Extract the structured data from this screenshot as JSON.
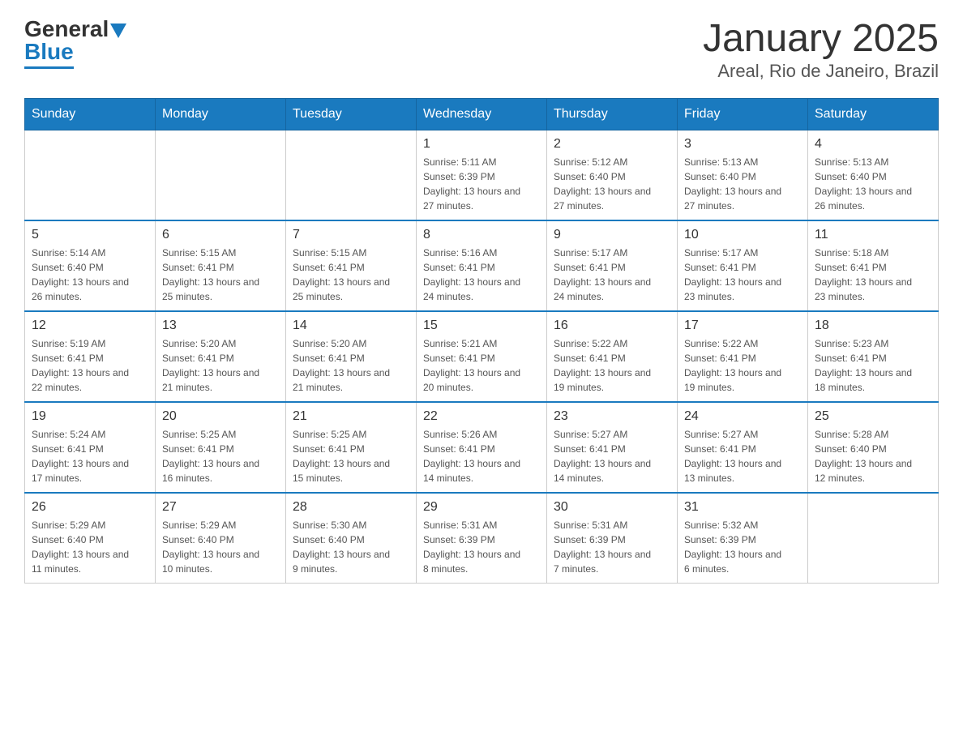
{
  "logo": {
    "general": "General",
    "blue": "Blue",
    "tagline": "GeneralBlue"
  },
  "title": "January 2025",
  "subtitle": "Areal, Rio de Janeiro, Brazil",
  "days_of_week": [
    "Sunday",
    "Monday",
    "Tuesday",
    "Wednesday",
    "Thursday",
    "Friday",
    "Saturday"
  ],
  "weeks": [
    [
      {
        "day": "",
        "sunrise": "",
        "sunset": "",
        "daylight": ""
      },
      {
        "day": "",
        "sunrise": "",
        "sunset": "",
        "daylight": ""
      },
      {
        "day": "",
        "sunrise": "",
        "sunset": "",
        "daylight": ""
      },
      {
        "day": "1",
        "sunrise": "Sunrise: 5:11 AM",
        "sunset": "Sunset: 6:39 PM",
        "daylight": "Daylight: 13 hours and 27 minutes."
      },
      {
        "day": "2",
        "sunrise": "Sunrise: 5:12 AM",
        "sunset": "Sunset: 6:40 PM",
        "daylight": "Daylight: 13 hours and 27 minutes."
      },
      {
        "day": "3",
        "sunrise": "Sunrise: 5:13 AM",
        "sunset": "Sunset: 6:40 PM",
        "daylight": "Daylight: 13 hours and 27 minutes."
      },
      {
        "day": "4",
        "sunrise": "Sunrise: 5:13 AM",
        "sunset": "Sunset: 6:40 PM",
        "daylight": "Daylight: 13 hours and 26 minutes."
      }
    ],
    [
      {
        "day": "5",
        "sunrise": "Sunrise: 5:14 AM",
        "sunset": "Sunset: 6:40 PM",
        "daylight": "Daylight: 13 hours and 26 minutes."
      },
      {
        "day": "6",
        "sunrise": "Sunrise: 5:15 AM",
        "sunset": "Sunset: 6:41 PM",
        "daylight": "Daylight: 13 hours and 25 minutes."
      },
      {
        "day": "7",
        "sunrise": "Sunrise: 5:15 AM",
        "sunset": "Sunset: 6:41 PM",
        "daylight": "Daylight: 13 hours and 25 minutes."
      },
      {
        "day": "8",
        "sunrise": "Sunrise: 5:16 AM",
        "sunset": "Sunset: 6:41 PM",
        "daylight": "Daylight: 13 hours and 24 minutes."
      },
      {
        "day": "9",
        "sunrise": "Sunrise: 5:17 AM",
        "sunset": "Sunset: 6:41 PM",
        "daylight": "Daylight: 13 hours and 24 minutes."
      },
      {
        "day": "10",
        "sunrise": "Sunrise: 5:17 AM",
        "sunset": "Sunset: 6:41 PM",
        "daylight": "Daylight: 13 hours and 23 minutes."
      },
      {
        "day": "11",
        "sunrise": "Sunrise: 5:18 AM",
        "sunset": "Sunset: 6:41 PM",
        "daylight": "Daylight: 13 hours and 23 minutes."
      }
    ],
    [
      {
        "day": "12",
        "sunrise": "Sunrise: 5:19 AM",
        "sunset": "Sunset: 6:41 PM",
        "daylight": "Daylight: 13 hours and 22 minutes."
      },
      {
        "day": "13",
        "sunrise": "Sunrise: 5:20 AM",
        "sunset": "Sunset: 6:41 PM",
        "daylight": "Daylight: 13 hours and 21 minutes."
      },
      {
        "day": "14",
        "sunrise": "Sunrise: 5:20 AM",
        "sunset": "Sunset: 6:41 PM",
        "daylight": "Daylight: 13 hours and 21 minutes."
      },
      {
        "day": "15",
        "sunrise": "Sunrise: 5:21 AM",
        "sunset": "Sunset: 6:41 PM",
        "daylight": "Daylight: 13 hours and 20 minutes."
      },
      {
        "day": "16",
        "sunrise": "Sunrise: 5:22 AM",
        "sunset": "Sunset: 6:41 PM",
        "daylight": "Daylight: 13 hours and 19 minutes."
      },
      {
        "day": "17",
        "sunrise": "Sunrise: 5:22 AM",
        "sunset": "Sunset: 6:41 PM",
        "daylight": "Daylight: 13 hours and 19 minutes."
      },
      {
        "day": "18",
        "sunrise": "Sunrise: 5:23 AM",
        "sunset": "Sunset: 6:41 PM",
        "daylight": "Daylight: 13 hours and 18 minutes."
      }
    ],
    [
      {
        "day": "19",
        "sunrise": "Sunrise: 5:24 AM",
        "sunset": "Sunset: 6:41 PM",
        "daylight": "Daylight: 13 hours and 17 minutes."
      },
      {
        "day": "20",
        "sunrise": "Sunrise: 5:25 AM",
        "sunset": "Sunset: 6:41 PM",
        "daylight": "Daylight: 13 hours and 16 minutes."
      },
      {
        "day": "21",
        "sunrise": "Sunrise: 5:25 AM",
        "sunset": "Sunset: 6:41 PM",
        "daylight": "Daylight: 13 hours and 15 minutes."
      },
      {
        "day": "22",
        "sunrise": "Sunrise: 5:26 AM",
        "sunset": "Sunset: 6:41 PM",
        "daylight": "Daylight: 13 hours and 14 minutes."
      },
      {
        "day": "23",
        "sunrise": "Sunrise: 5:27 AM",
        "sunset": "Sunset: 6:41 PM",
        "daylight": "Daylight: 13 hours and 14 minutes."
      },
      {
        "day": "24",
        "sunrise": "Sunrise: 5:27 AM",
        "sunset": "Sunset: 6:41 PM",
        "daylight": "Daylight: 13 hours and 13 minutes."
      },
      {
        "day": "25",
        "sunrise": "Sunrise: 5:28 AM",
        "sunset": "Sunset: 6:40 PM",
        "daylight": "Daylight: 13 hours and 12 minutes."
      }
    ],
    [
      {
        "day": "26",
        "sunrise": "Sunrise: 5:29 AM",
        "sunset": "Sunset: 6:40 PM",
        "daylight": "Daylight: 13 hours and 11 minutes."
      },
      {
        "day": "27",
        "sunrise": "Sunrise: 5:29 AM",
        "sunset": "Sunset: 6:40 PM",
        "daylight": "Daylight: 13 hours and 10 minutes."
      },
      {
        "day": "28",
        "sunrise": "Sunrise: 5:30 AM",
        "sunset": "Sunset: 6:40 PM",
        "daylight": "Daylight: 13 hours and 9 minutes."
      },
      {
        "day": "29",
        "sunrise": "Sunrise: 5:31 AM",
        "sunset": "Sunset: 6:39 PM",
        "daylight": "Daylight: 13 hours and 8 minutes."
      },
      {
        "day": "30",
        "sunrise": "Sunrise: 5:31 AM",
        "sunset": "Sunset: 6:39 PM",
        "daylight": "Daylight: 13 hours and 7 minutes."
      },
      {
        "day": "31",
        "sunrise": "Sunrise: 5:32 AM",
        "sunset": "Sunset: 6:39 PM",
        "daylight": "Daylight: 13 hours and 6 minutes."
      },
      {
        "day": "",
        "sunrise": "",
        "sunset": "",
        "daylight": ""
      }
    ]
  ]
}
